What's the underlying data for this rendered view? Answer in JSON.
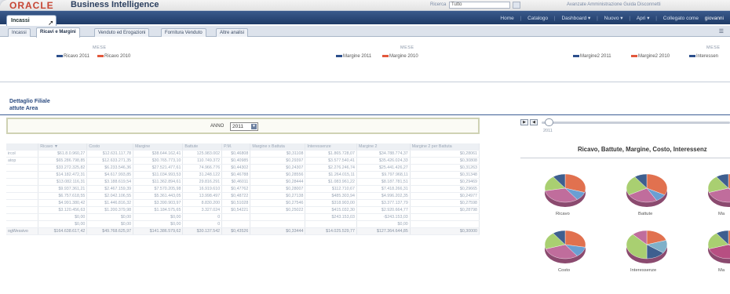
{
  "header": {
    "brand": "ORACLE",
    "product": "Business Intelligence",
    "search_label": "Ricerca",
    "search_value": "Tutto",
    "links": "Avanzate   Amministrazione   Guida   Disconnetti"
  },
  "dashboard_tab": "Incassi",
  "nav": {
    "home": "Home",
    "catalog": "Catalogo",
    "dashboard": "Dashboard ▾",
    "new": "Nuovo ▾",
    "open": "Apri ▾",
    "connected": "Collegato come",
    "user": "giovanni"
  },
  "page_tabs": [
    "Incassi",
    "Ricavi e Margini",
    "Venduto ed Erogazioni",
    "Fornitura Venduto",
    "Altre analisi"
  ],
  "legend_blocks": [
    {
      "axis": "MESE",
      "items": [
        {
          "label": "Ricavo 2011",
          "color": "#2c4f8c"
        },
        {
          "label": "Ricavo 2010",
          "color": "#e2583c"
        }
      ]
    },
    {
      "axis": "MESE",
      "items": [
        {
          "label": "Margine 2011",
          "color": "#2c4f8c"
        },
        {
          "label": "Margine 2010",
          "color": "#e2583c"
        }
      ]
    },
    {
      "axis": "MESE",
      "items": [
        {
          "label": "Margine2 2011",
          "color": "#2c4f8c"
        },
        {
          "label": "Margine2 2010",
          "color": "#e2583c"
        },
        {
          "label": "Interessen",
          "color": "#2c4f8c"
        }
      ]
    }
  ],
  "section": {
    "line1": "Dettaglio Filiale",
    "line2": "attute Area"
  },
  "prompt": {
    "label": "ANNO",
    "value": "2011"
  },
  "table": {
    "headers": [
      "",
      "Ricavo ▼",
      "Costo",
      "Margine",
      "Battute",
      "P.M.",
      "Margine x Battuta",
      "Interessenze",
      "Margine 2",
      "Margine 2 per Battuta"
    ],
    "rows": [
      [
        "ircol",
        "$61.8.0.960,27",
        "$12.631.117,78",
        "$38.644.162,41",
        "125.983.002",
        "$0,46808",
        "$0,31108",
        "$1.865.728,07",
        "$34.788.774,37",
        "$0,28061"
      ],
      [
        "atop",
        "$65.286.798,85",
        "$12.633.271,35",
        "$30.765.773,10",
        "110.749.372",
        "$0,40985",
        "$0,29397",
        "$3.577.540,41",
        "$35.426.024,33",
        "$0,30808"
      ],
      [
        "",
        "$33.272.325,82",
        "$6.233.546,36",
        "$27.521.477,61",
        "74.966.776",
        "$0,44302",
        "$0,24307",
        "$2.276.246,74",
        "$25.441.426,27",
        "$0,31263"
      ],
      [
        "",
        "$14.182.472,31",
        "$4.617.993,85",
        "$11.034.993,53",
        "31.248.122",
        "$0,46788",
        "$0,28556",
        "$1.264.015,11",
        "$9.797.968,11",
        "$0,31348"
      ],
      [
        "",
        "$13.082.116,31",
        "$3.188.619,54",
        "$11.362.894,61",
        "29.816.291",
        "$0,46011",
        "$0,28444",
        "$1.083.961,22",
        "$8.187.781,51",
        "$0,29469"
      ],
      [
        "",
        "$9.937.361,21",
        "$2.467.159,39",
        "$7.570.205,98",
        "16.919.610",
        "$0,47762",
        "$0,28007",
        "$112.710,67",
        "$7.418.266,31",
        "$0,29665"
      ],
      [
        "",
        "$6.757.618,55",
        "$2.042.106,55",
        "$5.361.443,05",
        "13.998.497",
        "$0,48722",
        "$0,27138",
        "$485.303,94",
        "$4.996.202,35",
        "$0,24977"
      ],
      [
        "",
        "$4.991.380,42",
        "$1.446.816,32",
        "$3.390.903,97",
        "8.830.200",
        "$0,51028",
        "$0,27546",
        "$318.903,00",
        "$3.377.137,79",
        "$0,27598"
      ],
      [
        "",
        "$3.120.456,63",
        "$1.200.379,98",
        "$1.184.575,65",
        "3.327.024",
        "$0,54221",
        "$0,25022",
        "$415.032,30",
        "$2.920.664,77",
        "$0,28798"
      ],
      [
        "",
        "$0,00",
        "$0,00",
        "$0,00",
        "0",
        "",
        "",
        "$243.153,03",
        "-$243.153,03",
        ""
      ],
      [
        "",
        "$0,00",
        "$0,00",
        "$0,00",
        "0",
        "",
        "",
        "",
        "$0,00",
        ""
      ]
    ],
    "total": [
      "ogWessivo",
      "$164.638.617,42",
      "$49.768.625,97",
      "$141.386.579,62",
      "$30.137.542",
      "$0,43526",
      "$0,33444",
      "$14.025.529,77",
      "$127.364.644,85",
      "$0,30000"
    ]
  },
  "slider": {
    "tick": "2011"
  },
  "chart_title": "Ricavo, Battute, Margine, Costo, Interessenz",
  "pie_colors": [
    "#e1714f",
    "#6a9fd3",
    "#c06d9c",
    "#a9cf71",
    "#3e5f8f",
    "#b74f82",
    "#7fb0c9"
  ],
  "pies": [
    {
      "label": "Ricavo"
    },
    {
      "label": "Battute"
    },
    {
      "label": "Ma"
    },
    {
      "label": "Costo"
    },
    {
      "label": "Interessenze"
    },
    {
      "label": "Ma"
    }
  ]
}
